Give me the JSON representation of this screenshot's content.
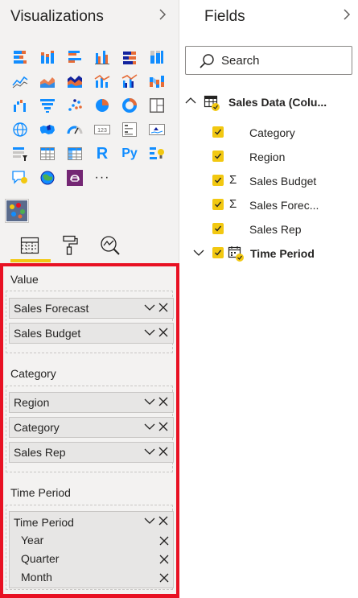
{
  "visualizations": {
    "title": "Visualizations",
    "icons": [
      [
        "stacked-bar-chart-icon",
        "stacked-column-chart-icon",
        "clustered-bar-chart-icon",
        "clustered-column-chart-icon",
        "100-stacked-bar-chart-icon",
        "100-stacked-column-chart-icon"
      ],
      [
        "line-chart-icon",
        "area-chart-icon",
        "stacked-area-chart-icon",
        "line-and-stacked-column-chart-icon",
        "line-and-clustered-column-chart-icon",
        "ribbon-chart-icon"
      ],
      [
        "waterfall-chart-icon",
        "funnel-chart-icon",
        "scatter-chart-icon",
        "pie-chart-icon",
        "donut-chart-icon",
        "treemap-icon"
      ],
      [
        "map-icon",
        "filled-map-icon",
        "gauge-icon",
        "card-icon",
        "multi-row-card-icon",
        "kpi-icon"
      ],
      [
        "slicer-icon",
        "table-icon",
        "matrix-icon",
        "r-script-visual-icon",
        "python-visual-icon",
        "key-influencers-icon"
      ],
      [
        "qa-visual-icon",
        "arcgis-map-icon",
        "power-apps-icon",
        "more-visuals-icon"
      ]
    ],
    "r_label": "R",
    "py_label": "Py",
    "card_label": "123",
    "more_label": "···",
    "tabs": [
      "fields-tab-icon",
      "format-tab-icon",
      "analytics-tab-icon"
    ]
  },
  "wells": {
    "value": {
      "label": "Value",
      "fields": [
        "Sales Forecast",
        "Sales Budget"
      ]
    },
    "category": {
      "label": "Category",
      "fields": [
        "Region",
        "Category",
        "Sales Rep"
      ]
    },
    "time_period": {
      "label": "Time Period",
      "field": "Time Period",
      "sub_fields": [
        "Year",
        "Quarter",
        "Month"
      ]
    }
  },
  "fields": {
    "title": "Fields",
    "search_placeholder": "Search",
    "table_name": "Sales Data (Colu...",
    "items": [
      {
        "label": "Category",
        "checked": true,
        "sigma": false
      },
      {
        "label": "Region",
        "checked": true,
        "sigma": false
      },
      {
        "label": "Sales Budget",
        "checked": true,
        "sigma": true
      },
      {
        "label": "Sales Forec...",
        "checked": true,
        "sigma": true
      },
      {
        "label": "Sales Rep",
        "checked": true,
        "sigma": false
      }
    ],
    "time_period": "Time Period"
  },
  "colors": {
    "accent": "#f2c811",
    "highlight_border": "#e81123",
    "pane_bg": "#f3f2f1",
    "chart_blue": "#118dff",
    "chart_orange": "#e66c37",
    "chart_navy": "#12239e"
  }
}
